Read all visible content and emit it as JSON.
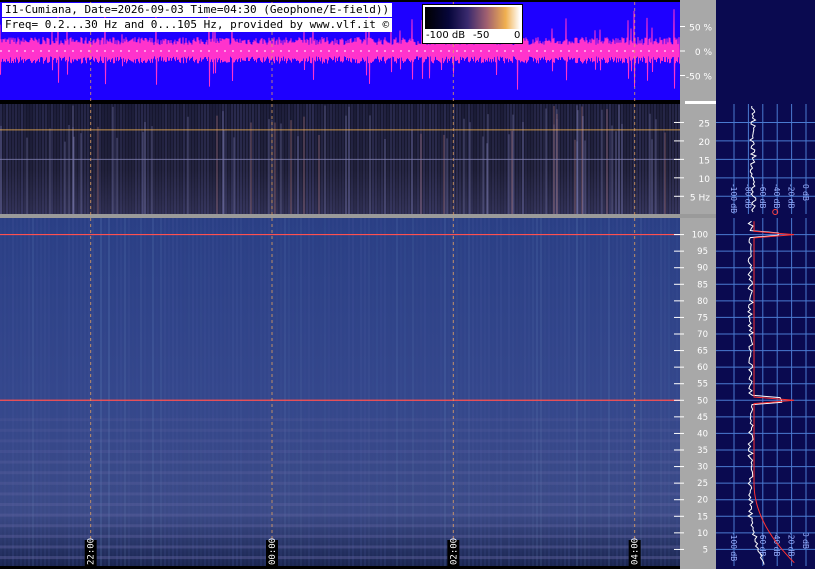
{
  "header": {
    "line1": "I1-Cumiana, Date=2026-09-03 Time=04:30 (Geophone/E-field))",
    "line2": "Freq= 0.2...30 Hz and 0...105 Hz, provided by www.vlf.it ©"
  },
  "colorbar": {
    "ticks": [
      "-100 dB",
      "-50",
      "0"
    ],
    "stops": [
      "#000000",
      "#06063a",
      "#3a2a6e",
      "#a06070",
      "#f0b050",
      "#ffffff"
    ]
  },
  "chart_data": [
    {
      "type": "line",
      "panel": "amplitude",
      "ytick_labels": [
        "50 %",
        "0 %",
        "-50 %"
      ],
      "yticks": [
        50,
        0,
        -50
      ],
      "ylim": [
        -100,
        100
      ],
      "colors": {
        "background": "#1e00ff",
        "signal": "#ff33cc"
      }
    },
    {
      "type": "heatmap",
      "panel": "spectrogram-low",
      "yticks": [
        5,
        10,
        15,
        20,
        25
      ],
      "ytick_labels": [
        "5 Hz",
        "10",
        "15",
        "20",
        "25"
      ],
      "ylim": [
        0.2,
        30
      ],
      "lines_hz": [
        15,
        23
      ]
    },
    {
      "type": "heatmap",
      "panel": "spectrogram-high",
      "yticks": [
        5,
        10,
        15,
        20,
        25,
        30,
        35,
        40,
        45,
        50,
        55,
        60,
        65,
        70,
        75,
        80,
        85,
        90,
        95,
        100
      ],
      "ytick_labels": [
        "5",
        "10",
        "15",
        "20",
        "25",
        "30",
        "35",
        "40",
        "45",
        "50",
        "55",
        "60",
        "65",
        "70",
        "75",
        "80",
        "85",
        "90",
        "95",
        "100"
      ],
      "ylim": [
        0,
        105
      ],
      "lines_hz": [
        50,
        100
      ]
    },
    {
      "type": "line",
      "panel": "time-axis",
      "time_labels": [
        "22:00",
        "00:00",
        "02:00",
        "04:00"
      ],
      "time_values": [
        -6.5,
        -4.5,
        -2.5,
        -0.5
      ],
      "xlim": [
        -7.5,
        0
      ]
    },
    {
      "type": "line",
      "panel": "spectrum-low",
      "db_labels": [
        "-100 dB",
        "-80 dB",
        "-60 dB",
        "-40 dB",
        "-20 dB",
        "0 dB"
      ],
      "db_values": [
        -100,
        -80,
        -60,
        -40,
        -20,
        0
      ]
    },
    {
      "type": "line",
      "panel": "spectrum-high",
      "db_labels": [
        "-100 dB",
        "-60 dB",
        "-40 dB",
        "-20 dB",
        "0 dB"
      ],
      "db_values": [
        -100,
        -60,
        -40,
        -20,
        0
      ],
      "peaks_hz": [
        50,
        100
      ]
    }
  ]
}
